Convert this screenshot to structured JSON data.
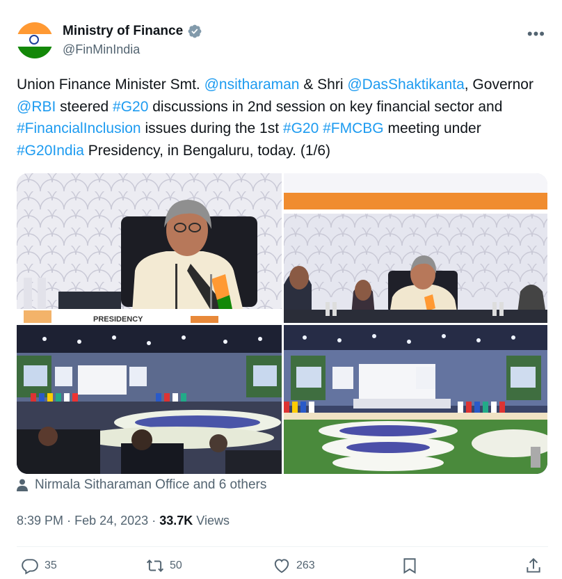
{
  "account": {
    "display_name": "Ministry of Finance",
    "handle": "@FinMinIndia",
    "verified_icon": "verified-badge-icon"
  },
  "tweet": {
    "segments": [
      {
        "text": "Union Finance Minister Smt. ",
        "link": false
      },
      {
        "text": "@nsitharaman",
        "link": true
      },
      {
        "text": " & Shri ",
        "link": false
      },
      {
        "text": "@DasShaktikanta",
        "link": true
      },
      {
        "text": ", Governor ",
        "link": false
      },
      {
        "text": "@RBI",
        "link": true
      },
      {
        "text": " steered ",
        "link": false
      },
      {
        "text": "#G20",
        "link": true
      },
      {
        "text": " discussions in 2nd session on key financial sector and ",
        "link": false
      },
      {
        "text": "#FinancialInclusion",
        "link": true
      },
      {
        "text": " issues during the 1st ",
        "link": false
      },
      {
        "text": "#G20",
        "link": true
      },
      {
        "text": " ",
        "link": false
      },
      {
        "text": "#FMCBG",
        "link": true
      },
      {
        "text": " meeting under ",
        "link": false
      },
      {
        "text": "#G20India",
        "link": true
      },
      {
        "text": " Presidency, in Bengaluru, today. (1/6)",
        "link": false
      }
    ]
  },
  "media": {
    "photo1_placard": "PRESIDENCY"
  },
  "tagged": {
    "text": "Nirmala Sitharaman Office and 6 others"
  },
  "meta": {
    "time": "8:39 PM",
    "separator": "·",
    "date": "Feb 24, 2023",
    "views_count": "33.7K",
    "views_label": "Views"
  },
  "actions": {
    "replies": "35",
    "reposts": "50",
    "likes": "263"
  },
  "colors": {
    "link": "#1d9bf0",
    "secondary": "#536471",
    "verified": "#829aab"
  }
}
